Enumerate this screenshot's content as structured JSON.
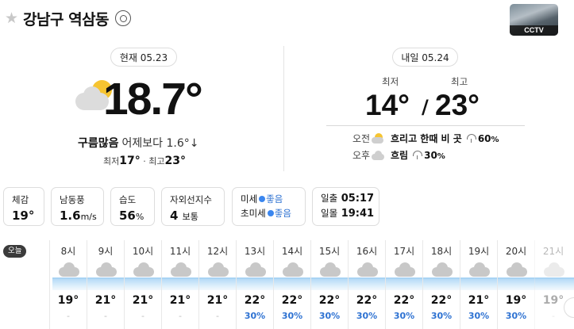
{
  "header": {
    "location": "강남구 역삼동",
    "cctv_label": "CCTV"
  },
  "today": {
    "label": "현재 05.23",
    "temp": "18.7°",
    "condition": "구름많음",
    "compare": "어제보다 1.6°↓",
    "min_label": "최저",
    "min": "17°",
    "max_label": "최고",
    "max": "23°",
    "sep": "·"
  },
  "tomorrow": {
    "label": "내일 05.24",
    "min_label": "최저",
    "max_label": "최고",
    "min": "14°",
    "max": "23°",
    "slash": "/",
    "am": {
      "time": "오전",
      "desc": "흐리고 한때 비 곳",
      "pop": "60",
      "unit": "%"
    },
    "pm": {
      "time": "오후",
      "desc": "흐림",
      "pop": "30",
      "unit": "%"
    }
  },
  "cards": {
    "feels": {
      "k": "체감",
      "v": "19°"
    },
    "wind": {
      "k": "남동풍",
      "v": "1.6",
      "unit": "m/s"
    },
    "humid": {
      "k": "습도",
      "v": "56",
      "unit": "%"
    },
    "uv": {
      "k": "자외선지수",
      "v": "4",
      "unit": "보통"
    },
    "dust": {
      "pm10": "미세",
      "pm25": "초미세",
      "status": "좋음"
    },
    "sun": {
      "rise_k": "일출",
      "rise": "05:17",
      "set_k": "일몰",
      "set": "19:41"
    }
  },
  "hourly": {
    "tag": "오늘",
    "hours": [
      {
        "time": "8시",
        "temp": "19°",
        "pop": "-"
      },
      {
        "time": "9시",
        "temp": "21°",
        "pop": "-"
      },
      {
        "time": "10시",
        "temp": "21°",
        "pop": "-"
      },
      {
        "time": "11시",
        "temp": "21°",
        "pop": "-"
      },
      {
        "time": "12시",
        "temp": "21°",
        "pop": "-"
      },
      {
        "time": "13시",
        "temp": "22°",
        "pop": "30%"
      },
      {
        "time": "14시",
        "temp": "22°",
        "pop": "30%"
      },
      {
        "time": "15시",
        "temp": "22°",
        "pop": "30%"
      },
      {
        "time": "16시",
        "temp": "22°",
        "pop": "30%"
      },
      {
        "time": "17시",
        "temp": "22°",
        "pop": "30%"
      },
      {
        "time": "18시",
        "temp": "22°",
        "pop": "30%"
      },
      {
        "time": "19시",
        "temp": "21°",
        "pop": "30%"
      },
      {
        "time": "20시",
        "temp": "19°",
        "pop": "30%"
      },
      {
        "time": "21시",
        "temp": "19°",
        "pop": "-"
      }
    ]
  },
  "icons": {
    "favorite": "star-icon",
    "gps": "target-icon",
    "today_weather": "cloud-sun-icon",
    "umbrella": "umbrella-icon"
  },
  "colors": {
    "accent_blue": "#2e72d2",
    "sun": "#f6c431",
    "cloud": "#c8c8c8"
  }
}
